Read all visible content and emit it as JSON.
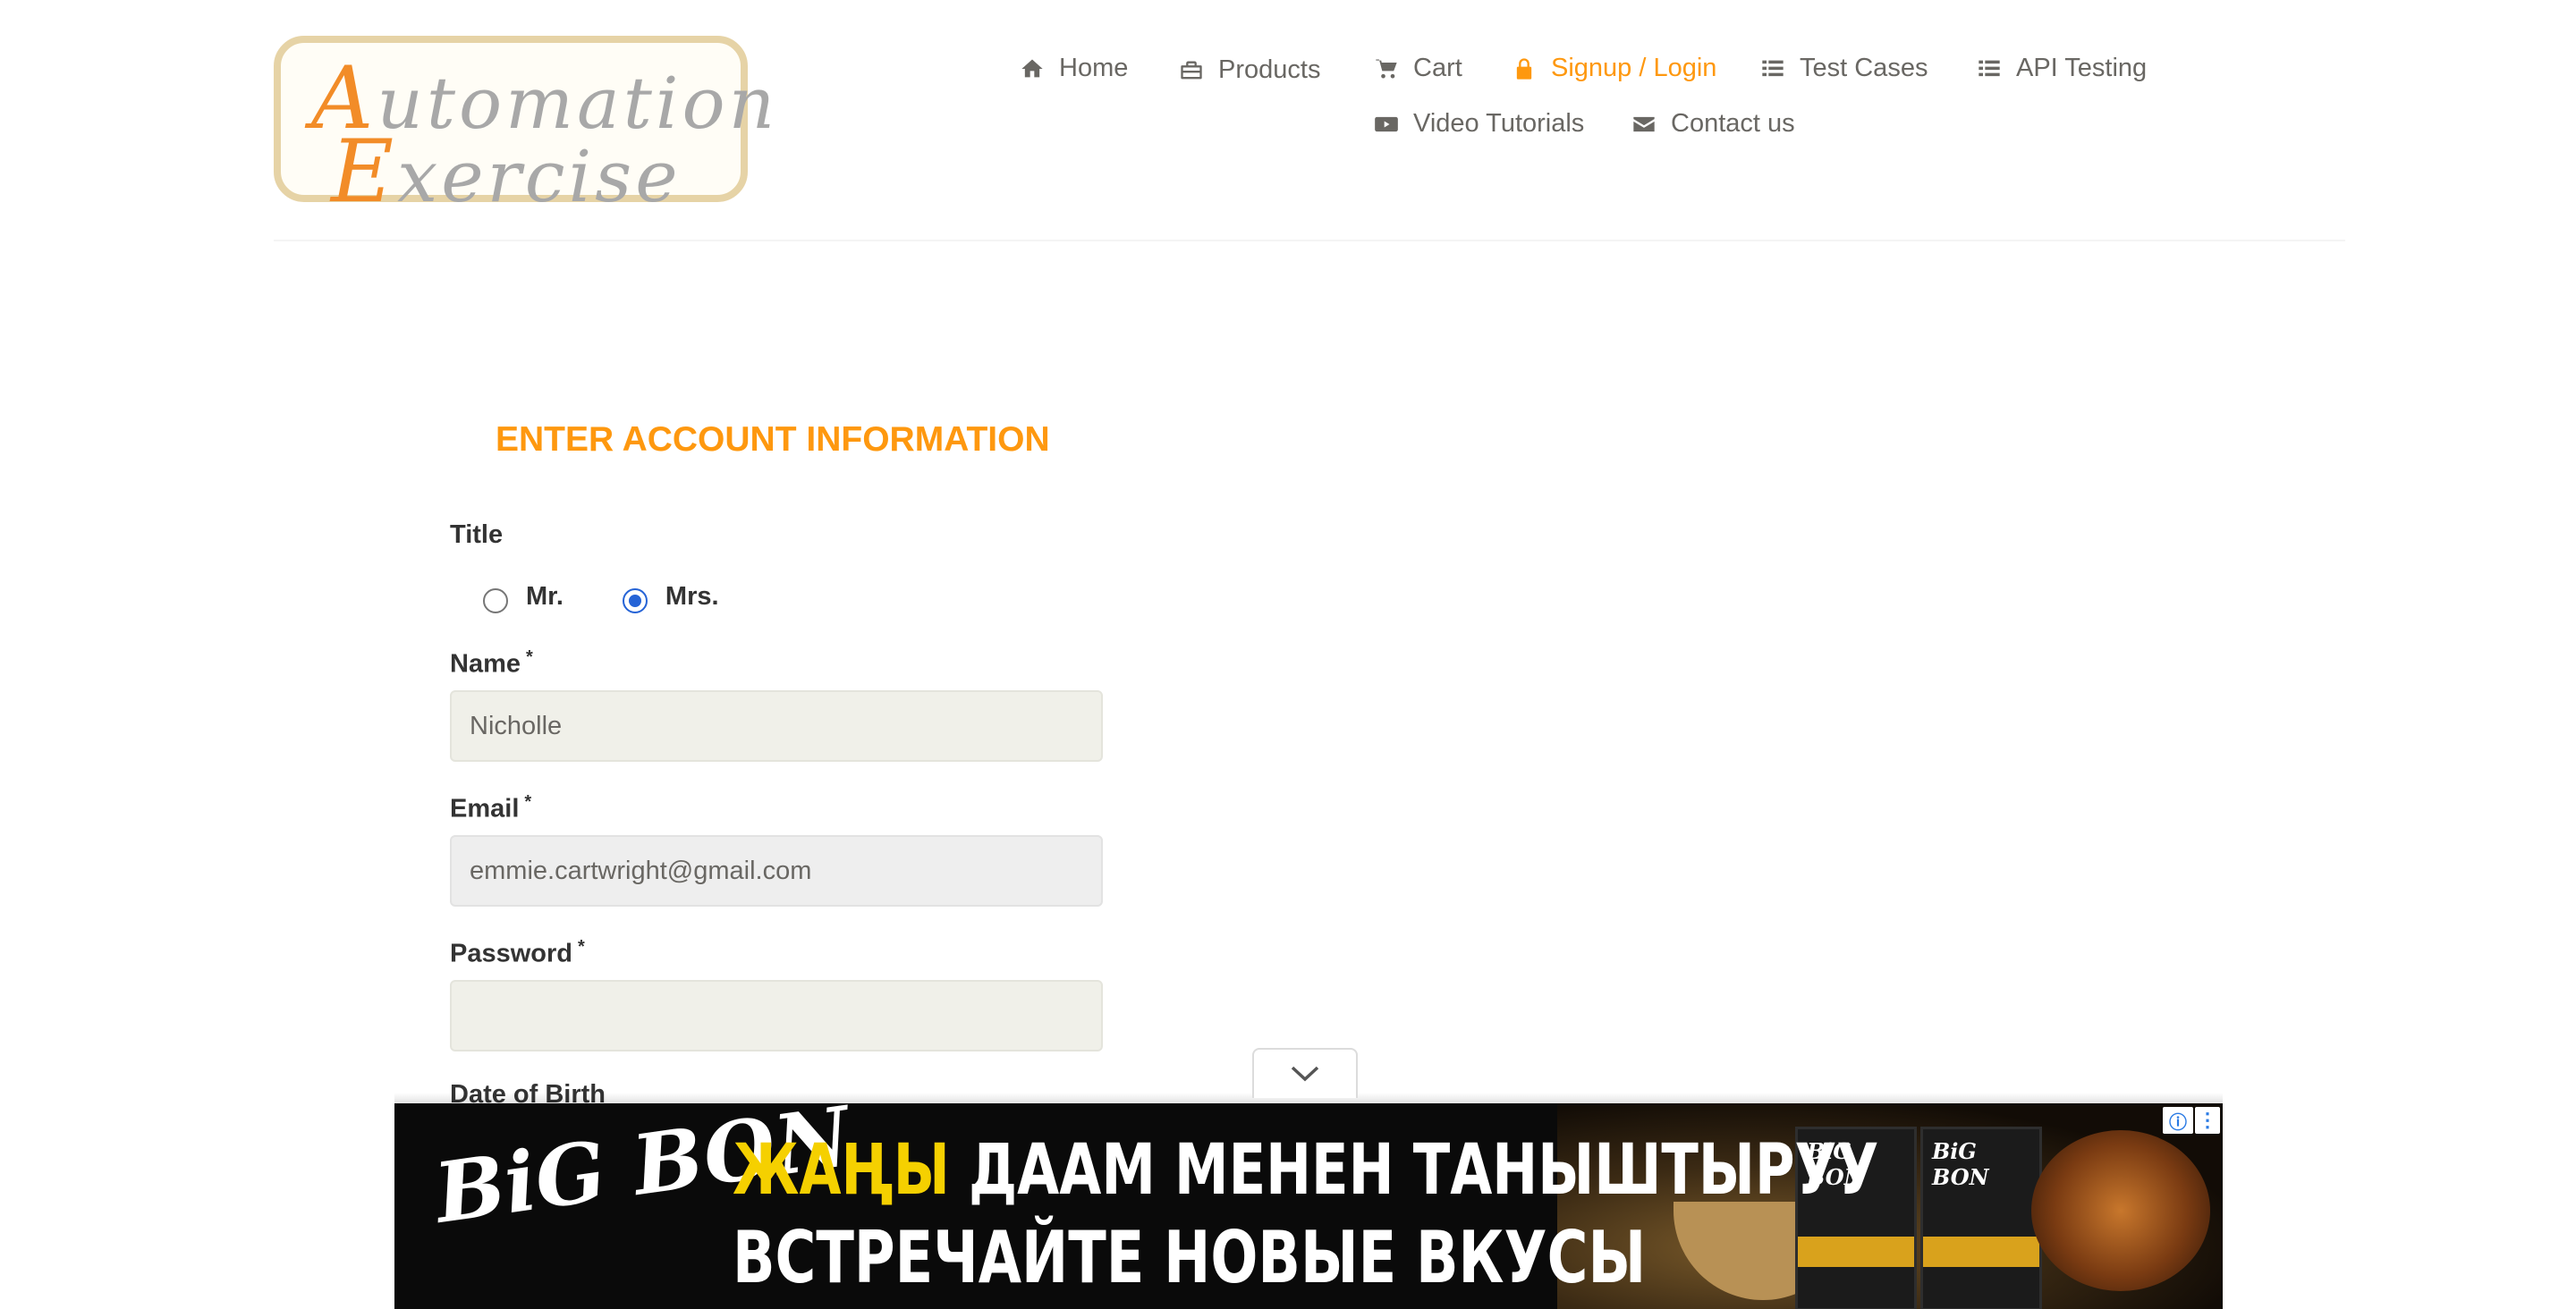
{
  "logo": {
    "line1": "utomation",
    "line1_cap": "A",
    "line2": "xercise",
    "line2_cap": "E"
  },
  "nav": {
    "items": [
      {
        "label": "Home",
        "icon": "home-icon"
      },
      {
        "label": "Products",
        "icon": "briefcase-icon"
      },
      {
        "label": "Cart",
        "icon": "cart-icon"
      },
      {
        "label": "Signup / Login",
        "icon": "lock-icon",
        "active": true
      },
      {
        "label": "Test Cases",
        "icon": "list-icon"
      },
      {
        "label": "API Testing",
        "icon": "list-icon"
      },
      {
        "label": "Video Tutorials",
        "icon": "youtube-play-icon"
      },
      {
        "label": "Contact us",
        "icon": "envelope-icon"
      }
    ]
  },
  "colors": {
    "accent": "#fe980f",
    "text": "#696763",
    "ad_highlight": "#f5d000"
  },
  "form": {
    "title": "ENTER ACCOUNT INFORMATION",
    "title_label": "Title",
    "radio_mr": "Mr.",
    "radio_mrs": "Mrs.",
    "selected_title": "Mrs.",
    "name_label": "Name",
    "name_value": "Nicholle",
    "email_label": "Email",
    "email_value": "emmie.cartwright@gmail.com",
    "password_label": "Password",
    "password_value": "",
    "required_mark": "*",
    "dob_label": "Date of Birth"
  },
  "ad": {
    "brand": "BiG BON",
    "line1_highlight": "ЖАҢЫ",
    "line1_rest": " ДААМ МЕНЕН ТАНЫШТЫРУУ",
    "line2": "ВСТРЕЧАЙТЕ НОВЫЕ ВКУСЫ",
    "pack_label": "BiG BON",
    "info_icon": "info-icon",
    "more_icon": "more-vertical-icon"
  }
}
